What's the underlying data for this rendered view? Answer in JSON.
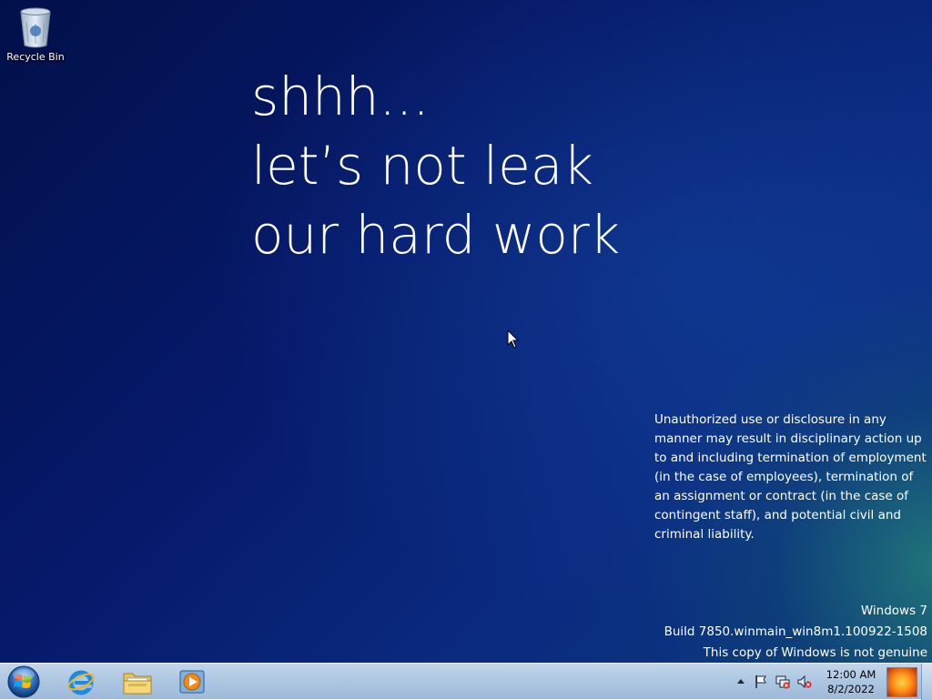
{
  "desktop": {
    "recycle_bin_label": "Recycle Bin",
    "headline": [
      "shhh...",
      "let’s not leak",
      "our hard work"
    ],
    "legal_text": "Unauthorized use or disclosure in any manner may result in disciplinary action up to and including termination of employment (in the case of employees), termination of an assignment or contract (in the case of contingent staff), and potential civil and criminal liability.",
    "watermark": {
      "os_name": "Windows 7",
      "build": "Build 7850.winmain_win8m1.100922-1508",
      "genuine": "This copy of Windows is not genuine"
    }
  },
  "taskbar": {
    "pinned": [
      {
        "name": "start-button",
        "icon": "windows-orb-icon"
      },
      {
        "name": "internet-explorer",
        "icon": "internet-explorer-icon"
      },
      {
        "name": "windows-explorer",
        "icon": "folder-icon"
      },
      {
        "name": "windows-media-player",
        "icon": "media-player-icon"
      }
    ],
    "tray_icons": [
      "show-hidden-icons-arrow",
      "action-center-flag-icon",
      "network-icon",
      "volume-muted-icon"
    ],
    "clock": {
      "time": "12:00 AM",
      "date": "8/2/2022"
    }
  }
}
